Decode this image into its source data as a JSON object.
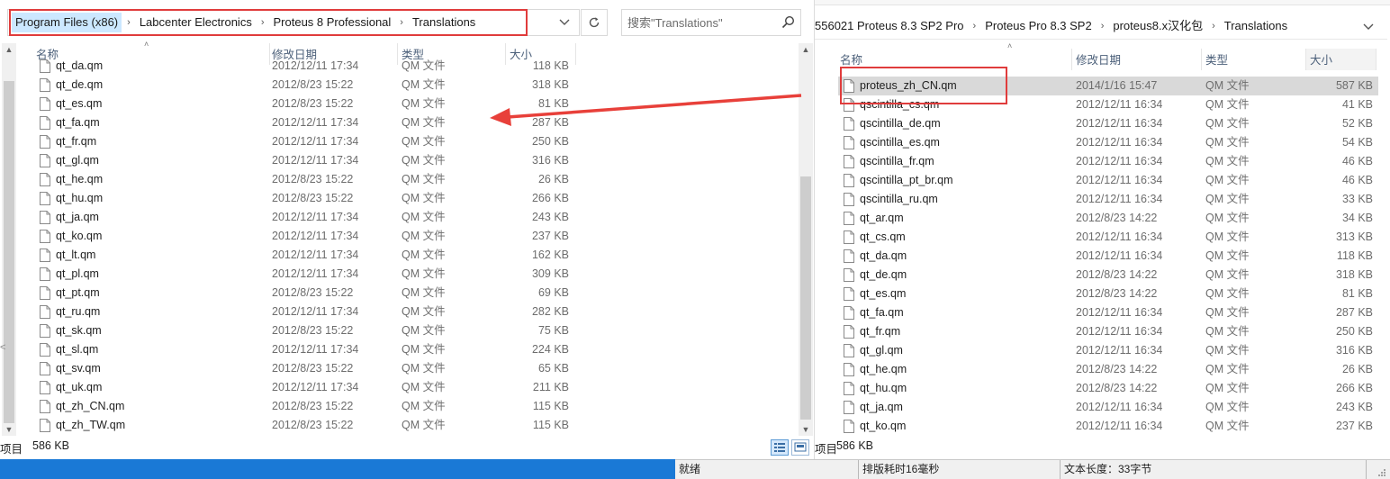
{
  "left_window": {
    "breadcrumb": [
      "Program Files (x86)",
      "Labcenter Electronics",
      "Proteus 8 Professional",
      "Translations"
    ],
    "search_placeholder": "搜索\"Translations\"",
    "columns": {
      "name": "名称",
      "date": "修改日期",
      "type": "类型",
      "size": "大小"
    },
    "partial_row": {
      "name": "qt_da.qm",
      "date": "2012/12/11 17:34",
      "type": "QM 文件",
      "size": "118 KB"
    },
    "files": [
      {
        "name": "qt_de.qm",
        "date": "2012/8/23 15:22",
        "type": "QM 文件",
        "size": "318 KB"
      },
      {
        "name": "qt_es.qm",
        "date": "2012/8/23 15:22",
        "type": "QM 文件",
        "size": "81 KB"
      },
      {
        "name": "qt_fa.qm",
        "date": "2012/12/11 17:34",
        "type": "QM 文件",
        "size": "287 KB"
      },
      {
        "name": "qt_fr.qm",
        "date": "2012/12/11 17:34",
        "type": "QM 文件",
        "size": "250 KB"
      },
      {
        "name": "qt_gl.qm",
        "date": "2012/12/11 17:34",
        "type": "QM 文件",
        "size": "316 KB"
      },
      {
        "name": "qt_he.qm",
        "date": "2012/8/23 15:22",
        "type": "QM 文件",
        "size": "26 KB"
      },
      {
        "name": "qt_hu.qm",
        "date": "2012/8/23 15:22",
        "type": "QM 文件",
        "size": "266 KB"
      },
      {
        "name": "qt_ja.qm",
        "date": "2012/12/11 17:34",
        "type": "QM 文件",
        "size": "243 KB"
      },
      {
        "name": "qt_ko.qm",
        "date": "2012/12/11 17:34",
        "type": "QM 文件",
        "size": "237 KB"
      },
      {
        "name": "qt_lt.qm",
        "date": "2012/12/11 17:34",
        "type": "QM 文件",
        "size": "162 KB"
      },
      {
        "name": "qt_pl.qm",
        "date": "2012/12/11 17:34",
        "type": "QM 文件",
        "size": "309 KB"
      },
      {
        "name": "qt_pt.qm",
        "date": "2012/8/23 15:22",
        "type": "QM 文件",
        "size": "69 KB"
      },
      {
        "name": "qt_ru.qm",
        "date": "2012/12/11 17:34",
        "type": "QM 文件",
        "size": "282 KB"
      },
      {
        "name": "qt_sk.qm",
        "date": "2012/8/23 15:22",
        "type": "QM 文件",
        "size": "75 KB"
      },
      {
        "name": "qt_sl.qm",
        "date": "2012/12/11 17:34",
        "type": "QM 文件",
        "size": "224 KB"
      },
      {
        "name": "qt_sv.qm",
        "date": "2012/8/23 15:22",
        "type": "QM 文件",
        "size": "65 KB"
      },
      {
        "name": "qt_uk.qm",
        "date": "2012/12/11 17:34",
        "type": "QM 文件",
        "size": "211 KB"
      },
      {
        "name": "qt_zh_CN.qm",
        "date": "2012/8/23 15:22",
        "type": "QM 文件",
        "size": "115 KB"
      },
      {
        "name": "qt_zh_TW.qm",
        "date": "2012/8/23 15:22",
        "type": "QM 文件",
        "size": "115 KB"
      }
    ],
    "status_items": "项目",
    "status_size": "586 KB",
    "left_edge_mark": "<",
    "scroll_up": "▲",
    "scroll_down": "▼"
  },
  "right_window": {
    "breadcrumb": [
      "556021 Proteus 8.3 SP2 Pro",
      "Proteus Pro 8.3 SP2",
      "proteus8.x汉化包",
      "Translations"
    ],
    "columns": {
      "name": "名称",
      "date": "修改日期",
      "type": "类型",
      "size": "大小"
    },
    "files": [
      {
        "name": "proteus_zh_CN.qm",
        "date": "2014/1/16 15:47",
        "type": "QM 文件",
        "size": "587 KB",
        "selected": true
      },
      {
        "name": "qscintilla_cs.qm",
        "date": "2012/12/11 16:34",
        "type": "QM 文件",
        "size": "41 KB"
      },
      {
        "name": "qscintilla_de.qm",
        "date": "2012/12/11 16:34",
        "type": "QM 文件",
        "size": "52 KB"
      },
      {
        "name": "qscintilla_es.qm",
        "date": "2012/12/11 16:34",
        "type": "QM 文件",
        "size": "54 KB"
      },
      {
        "name": "qscintilla_fr.qm",
        "date": "2012/12/11 16:34",
        "type": "QM 文件",
        "size": "46 KB"
      },
      {
        "name": "qscintilla_pt_br.qm",
        "date": "2012/12/11 16:34",
        "type": "QM 文件",
        "size": "46 KB"
      },
      {
        "name": "qscintilla_ru.qm",
        "date": "2012/12/11 16:34",
        "type": "QM 文件",
        "size": "33 KB"
      },
      {
        "name": "qt_ar.qm",
        "date": "2012/8/23 14:22",
        "type": "QM 文件",
        "size": "34 KB"
      },
      {
        "name": "qt_cs.qm",
        "date": "2012/12/11 16:34",
        "type": "QM 文件",
        "size": "313 KB"
      },
      {
        "name": "qt_da.qm",
        "date": "2012/12/11 16:34",
        "type": "QM 文件",
        "size": "118 KB"
      },
      {
        "name": "qt_de.qm",
        "date": "2012/8/23 14:22",
        "type": "QM 文件",
        "size": "318 KB"
      },
      {
        "name": "qt_es.qm",
        "date": "2012/8/23 14:22",
        "type": "QM 文件",
        "size": "81 KB"
      },
      {
        "name": "qt_fa.qm",
        "date": "2012/12/11 16:34",
        "type": "QM 文件",
        "size": "287 KB"
      },
      {
        "name": "qt_fr.qm",
        "date": "2012/12/11 16:34",
        "type": "QM 文件",
        "size": "250 KB"
      },
      {
        "name": "qt_gl.qm",
        "date": "2012/12/11 16:34",
        "type": "QM 文件",
        "size": "316 KB"
      },
      {
        "name": "qt_he.qm",
        "date": "2012/8/23 14:22",
        "type": "QM 文件",
        "size": "26 KB"
      },
      {
        "name": "qt_hu.qm",
        "date": "2012/8/23 14:22",
        "type": "QM 文件",
        "size": "266 KB"
      },
      {
        "name": "qt_ja.qm",
        "date": "2012/12/11 16:34",
        "type": "QM 文件",
        "size": "243 KB"
      },
      {
        "name": "qt_ko.qm",
        "date": "2012/12/11 16:34",
        "type": "QM 文件",
        "size": "237 KB"
      }
    ],
    "status_items": "项目",
    "status_size": "586 KB",
    "dropdown_glyph": "⌄"
  },
  "editor_status": {
    "ready": "就绪",
    "time": "排版耗时16毫秒",
    "length": "文本长度：33字节"
  },
  "colors": {
    "highlight": "#e03c3c",
    "selected_breadcrumb": "#cce8ff",
    "selected_row": "#d9d9d9",
    "taskbar": "#1a79d6"
  }
}
